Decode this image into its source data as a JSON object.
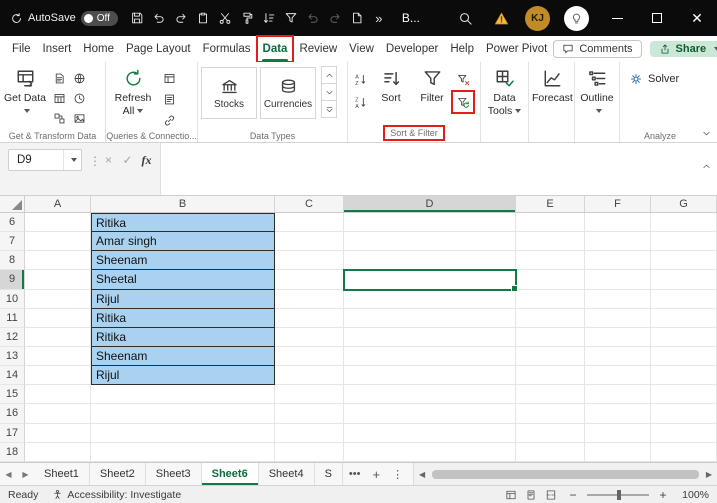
{
  "title_bar": {
    "autosave_label": "AutoSave",
    "autosave_state": "Off",
    "qat_icons": [
      "save-icon",
      "undo-icon",
      "redo-icon",
      "paste-icon",
      "cut-icon",
      "format-painter-icon",
      "sort-asc-icon",
      "filter-icon",
      "undo-dim-icon",
      "redo-dim-icon",
      "new-file-icon",
      "overflow-icon"
    ],
    "doc_title": "B...",
    "avatar_initials": "KJ"
  },
  "ribbon_tabs": {
    "items": [
      "File",
      "Insert",
      "Home",
      "Page Layout",
      "Formulas",
      "Data",
      "Review",
      "View",
      "Developer",
      "Help",
      "Power Pivot"
    ],
    "active": "Data"
  },
  "actions": {
    "comments": "Comments",
    "share": "Share"
  },
  "ribbon": {
    "groups": {
      "get_transform": {
        "button": "Get Data",
        "label": "Get & Transform Data",
        "small_icons": [
          "from-text-csv-icon",
          "from-web-icon",
          "from-table-range-icon",
          "recent-sources-icon",
          "existing-connections-icon",
          "from-picture-icon"
        ]
      },
      "queries": {
        "button": "Refresh All",
        "label": "Queries & Connectio...",
        "small_icons": [
          "queries-connections-icon",
          "properties-icon",
          "workbook-links-icon"
        ]
      },
      "data_types": {
        "tiles": [
          "Stocks",
          "Currencies"
        ],
        "label": "Data Types",
        "gallery_icons": [
          "gallery-up-icon",
          "gallery-down-icon",
          "gallery-more-icon"
        ]
      },
      "sort_filter": {
        "sort": "Sort",
        "filter": "Filter",
        "label": "Sort & Filter",
        "left_icons": [
          "sort-az-icon",
          "sort-za-icon"
        ],
        "right_icons": [
          "clear-filter-icon",
          "reapply-filter-icon"
        ]
      },
      "data_tools": {
        "button": "Data Tools"
      },
      "forecast": {
        "button": "Forecast"
      },
      "outline": {
        "button": "Outline"
      },
      "analyze": {
        "button": "Solver",
        "label": "Analyze"
      }
    }
  },
  "formula_bar": {
    "name_box_value": "D9",
    "cancel_glyph": "×",
    "enter_glyph": "✓",
    "fx_label": "fx",
    "formula_value": ""
  },
  "grid": {
    "columns": [
      "A",
      "B",
      "C",
      "D",
      "E",
      "F",
      "G"
    ],
    "row_numbers": [
      6,
      7,
      8,
      9,
      10,
      11,
      12,
      13,
      14,
      15,
      16,
      17,
      18
    ],
    "b_values": {
      "6": "Ritika",
      "7": "Amar singh",
      "8": "Sheenam",
      "9": "Sheetal",
      "10": "Rijul",
      "11": "Ritika",
      "12": "Ritika",
      "13": "Sheenam",
      "14": "Rijul"
    },
    "selection": {
      "cell": "D9",
      "column": "D",
      "row": 9
    },
    "fill_color": "#A9D2F1"
  },
  "sheet_tabs": {
    "nav_left": "◀",
    "nav_right": "▶",
    "tabs": [
      "Sheet1",
      "Sheet2",
      "Sheet3",
      "Sheet6",
      "Sheet4",
      "S"
    ],
    "active": "Sheet6",
    "overflow": "•••",
    "add": "+",
    "menu": "⋮"
  },
  "status_bar": {
    "ready": "Ready",
    "accessibility": "Accessibility: Investigate",
    "zoom": "100%",
    "view_icons": [
      "normal-view-icon",
      "page-layout-icon",
      "page-break-preview-icon"
    ]
  },
  "annotation_color": "#E11D1D"
}
